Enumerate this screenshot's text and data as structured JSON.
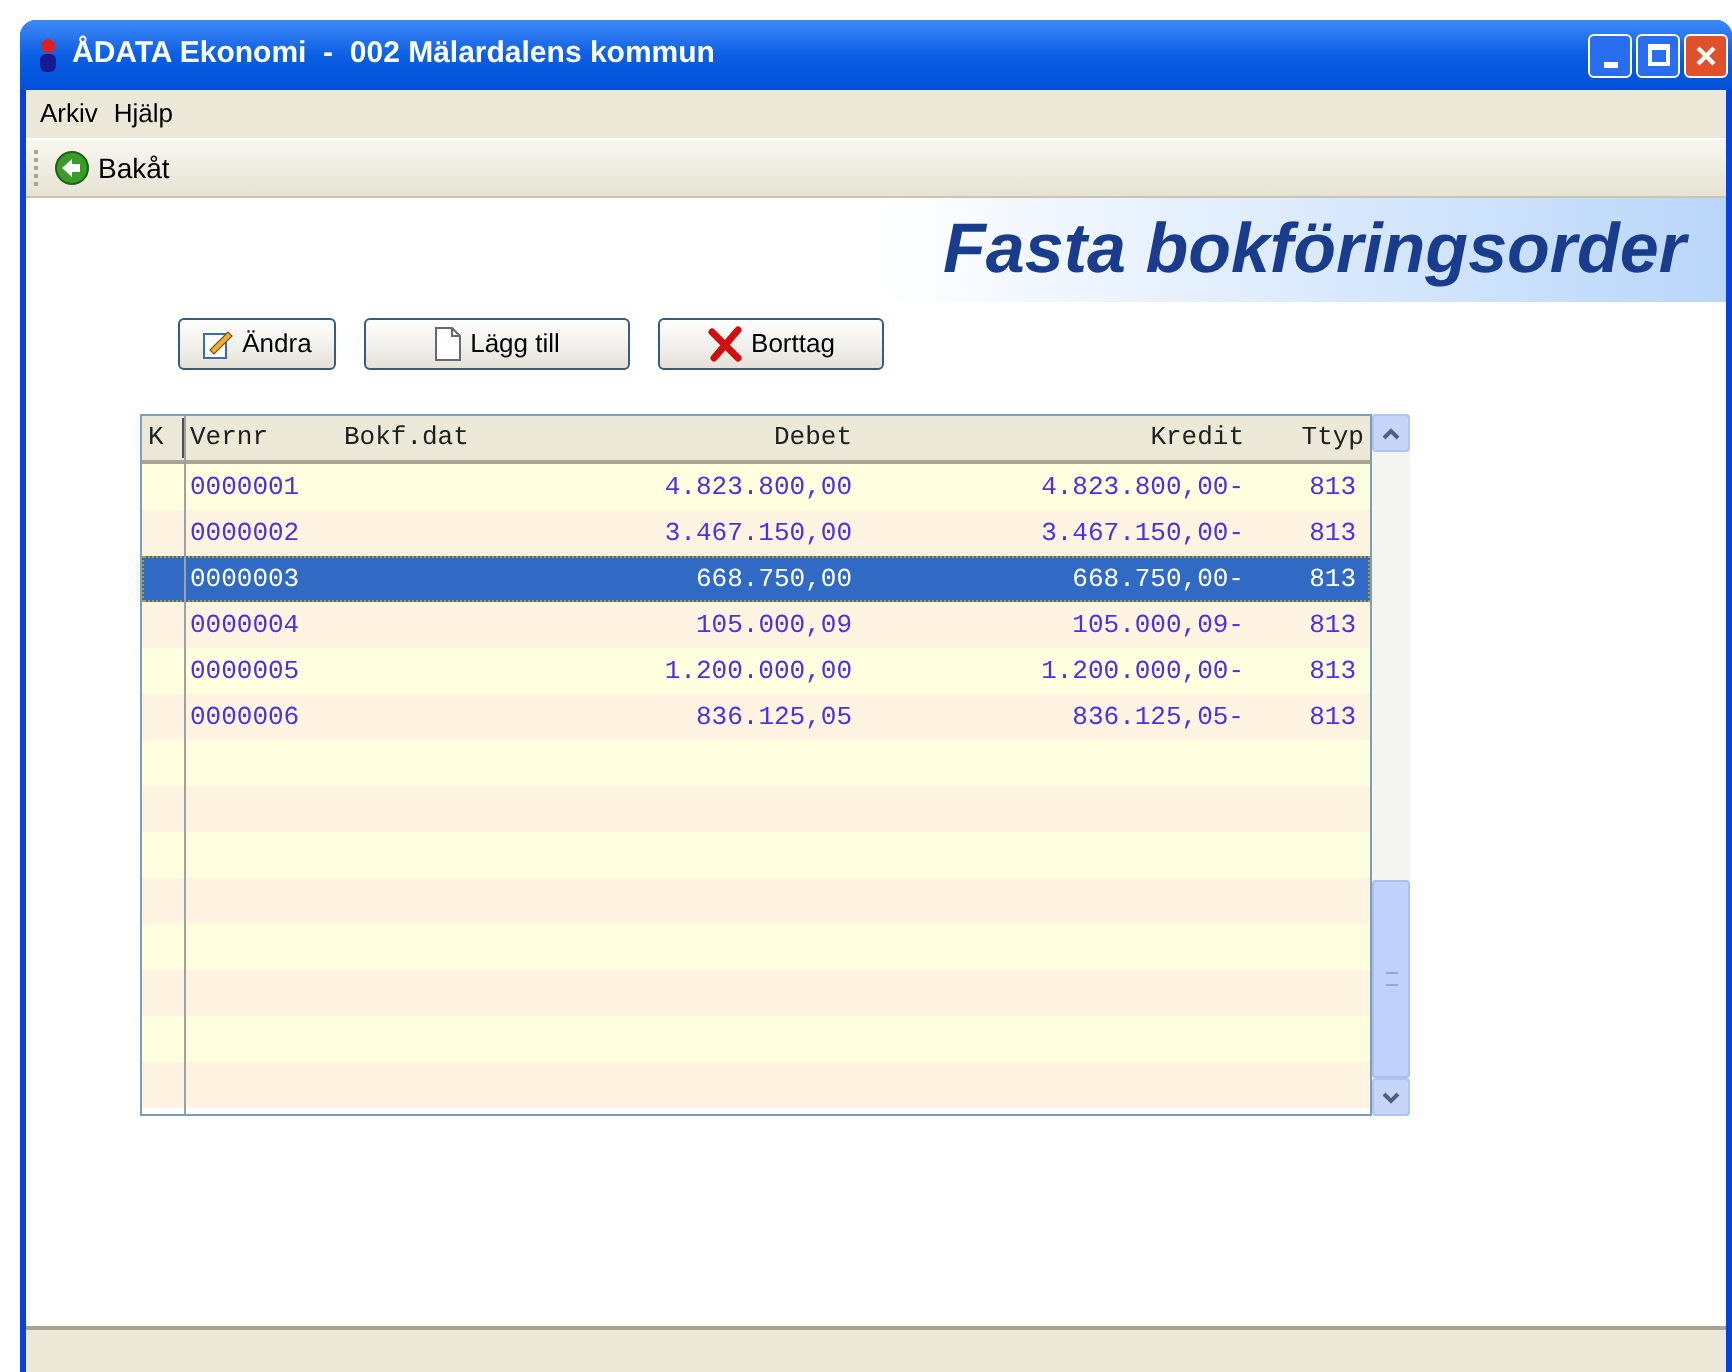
{
  "window": {
    "title": "ÅDATA Ekonomi  -  002 Mälardalens kommun"
  },
  "menu": [
    "Arkiv",
    "Hjälp"
  ],
  "toolbar": [
    {
      "label": "Bakåt"
    }
  ],
  "banner": {
    "title": "Fasta bokföringsorder"
  },
  "actions": [
    {
      "kind": "edit",
      "label": "Ändra"
    },
    {
      "kind": "add",
      "label": "Lägg till"
    },
    {
      "kind": "delete",
      "label": "Borttag"
    }
  ],
  "table": {
    "columns": [
      "K",
      "Vernr",
      "Bokf.dat",
      "Debet",
      "Kredit",
      "Ttyp"
    ],
    "rows": [
      {
        "vernr": "0000001",
        "debet": "4.823.800,00",
        "kredit": "4.823.800,00-",
        "ttyp": "813",
        "selected": false
      },
      {
        "vernr": "0000002",
        "debet": "3.467.150,00",
        "kredit": "3.467.150,00-",
        "ttyp": "813",
        "selected": false
      },
      {
        "vernr": "0000003",
        "debet": "668.750,00",
        "kredit": "668.750,00-",
        "ttyp": "813",
        "selected": true
      },
      {
        "vernr": "0000004",
        "debet": "105.000,09",
        "kredit": "105.000,09-",
        "ttyp": "813",
        "selected": false
      },
      {
        "vernr": "0000005",
        "debet": "1.200.000,00",
        "kredit": "1.200.000,00-",
        "ttyp": "813",
        "selected": false
      },
      {
        "vernr": "0000006",
        "debet": "836.125,05",
        "kredit": "836.125,05-",
        "ttyp": "813",
        "selected": false
      }
    ]
  }
}
